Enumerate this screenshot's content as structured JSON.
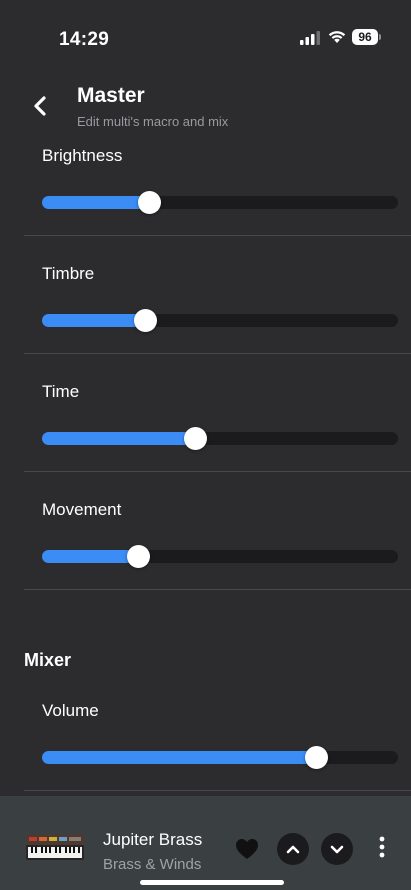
{
  "status": {
    "time": "14:29",
    "battery": "96",
    "icons": [
      "cellular-signal-icon",
      "wifi-icon",
      "battery-icon"
    ]
  },
  "header": {
    "title": "Master",
    "subtitle": "Edit multi's macro and mix",
    "back_icon": "chevron-left-icon"
  },
  "macros": [
    {
      "label": "Brightness",
      "value": 0.3
    },
    {
      "label": "Timbre",
      "value": 0.29
    },
    {
      "label": "Time",
      "value": 0.43
    },
    {
      "label": "Movement",
      "value": 0.27
    }
  ],
  "mixer": {
    "title": "Mixer",
    "items": [
      {
        "label": "Volume",
        "value": 0.77
      }
    ]
  },
  "player": {
    "title": "Jupiter Brass",
    "subtitle": "Brass & Winds",
    "icons": [
      "synth-thumbnail",
      "heart-icon",
      "chevron-up-icon",
      "chevron-down-icon",
      "more-vertical-icon"
    ]
  },
  "colors": {
    "background": "#2c2c2e",
    "accent": "#3b8cf5",
    "track": "#1b1b1d",
    "player_bg": "#3a3f42"
  }
}
